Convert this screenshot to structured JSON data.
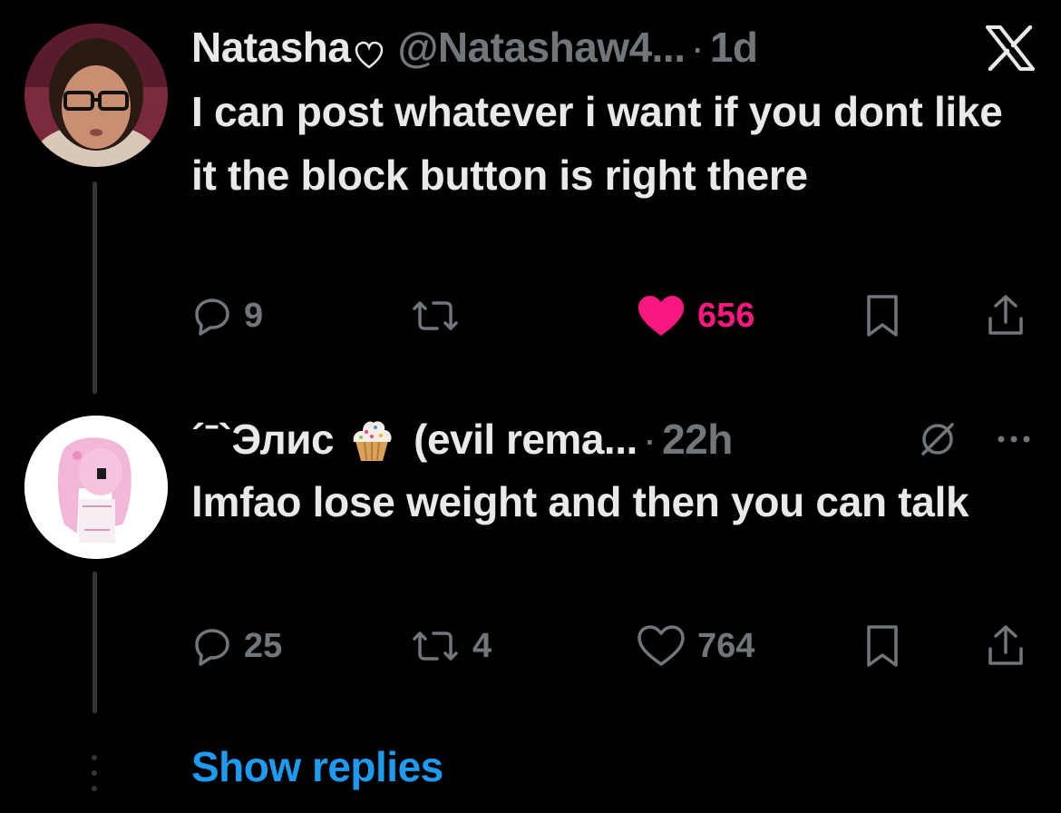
{
  "tweet1": {
    "display_name": "Natasha",
    "name_emoji_icon": "heart-outline-icon",
    "handle": "@Natashaw4...",
    "separator": "·",
    "time": "1d",
    "platform_icon": "x-logo-icon",
    "text": "I can post whatever i want if you dont like it the block button is right there",
    "replies": "9",
    "retweets": "",
    "likes": "656",
    "liked": true,
    "like_color": "#f91880"
  },
  "tweet2": {
    "display_name": "´ˉ`Элис",
    "name_emoji_icon": "cupcake-icon",
    "name_suffix": "(evil rema...",
    "separator": "·",
    "time": "22h",
    "text": "lmfao lose weight and then you can talk",
    "replies": "25",
    "retweets": "4",
    "likes": "764",
    "liked": false
  },
  "show_replies_label": "Show replies",
  "colors": {
    "background": "#000000",
    "primary_text": "#e7e9ea",
    "secondary_text": "#71767b",
    "link": "#1d9bf0",
    "like": "#f91880",
    "thread_line": "#333639"
  }
}
